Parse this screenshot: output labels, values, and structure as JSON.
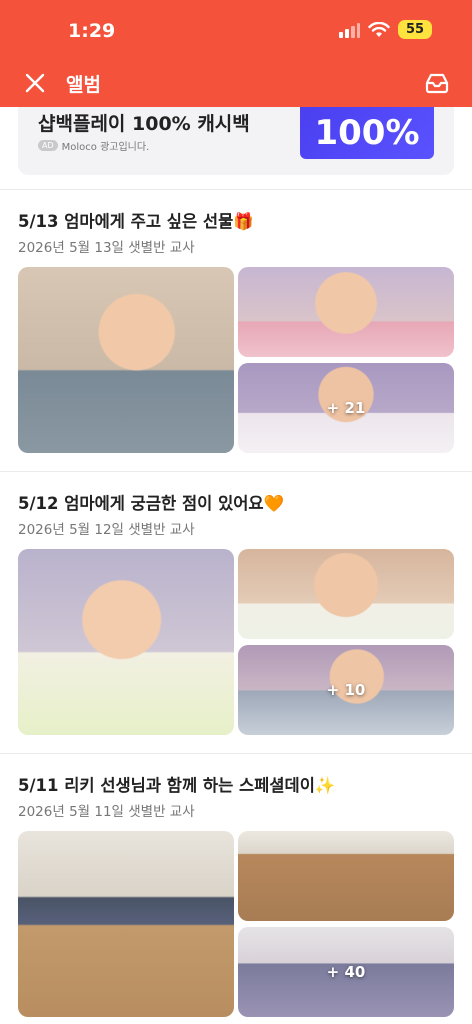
{
  "status_bar": {
    "time": "1:29",
    "battery": "55"
  },
  "header": {
    "title": "앨범"
  },
  "ad": {
    "title": "샵백플레이 100% 캐시백",
    "chip": "AD",
    "subtitle": "Moloco 광고입니다.",
    "image_text": "100%"
  },
  "posts": [
    {
      "title": "5/13 엄마에게 주고 싶은 선물🎁",
      "meta": "2026년 5월 13일 샛별반 교사",
      "more": "+ 21"
    },
    {
      "title": "5/12 엄마에게 궁금한 점이 있어요🧡",
      "meta": "2026년 5월 12일 샛별반 교사",
      "more": "+ 10"
    },
    {
      "title": "5/11 리키 선생님과 함께 하는 스페셜데이✨",
      "meta": "2026년 5월 11일 샛별반 교사",
      "more": "+ 40"
    }
  ],
  "colors": {
    "header": "#f5523c",
    "ad_accent": "#4b3ff0"
  },
  "icons": [
    "wifi-icon",
    "cellular-icon",
    "close-icon",
    "inbox-icon"
  ]
}
